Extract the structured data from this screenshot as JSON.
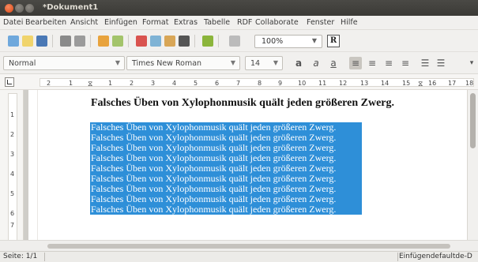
{
  "window": {
    "title": "*Dokument1"
  },
  "menu": [
    "Datei",
    "Bearbeiten",
    "Ansicht",
    "Einfügen",
    "Format",
    "Extras",
    "Tabelle",
    "RDF",
    "Collaborate",
    "Fenster",
    "Hilfe"
  ],
  "toolbar": {
    "zoom": "100%",
    "zoom_icon": "chevron-down-icon",
    "r_button": "R"
  },
  "format": {
    "style": "Normal",
    "font": "Times New Roman",
    "size": "14"
  },
  "ruler": {
    "labels": [
      "2",
      "1",
      "1",
      "2",
      "3",
      "4",
      "5",
      "6",
      "7",
      "8",
      "9",
      "10",
      "11",
      "12",
      "13",
      "14",
      "15",
      "16",
      "17",
      "18"
    ]
  },
  "vruler": {
    "labels": [
      "1",
      "2",
      "3",
      "4",
      "5",
      "6",
      "7"
    ]
  },
  "document": {
    "heading": "Falsches Üben von Xylophonmusik quält jeden größeren Zwerg.",
    "lines": [
      "Falsches Üben von Xylophonmusik quält jeden größeren Zwerg.",
      "Falsches Üben von Xylophonmusik quält jeden größeren Zwerg.",
      "Falsches Üben von Xylophonmusik quält jeden größeren Zwerg.",
      "Falsches Üben von Xylophonmusik quält jeden größeren Zwerg.",
      "Falsches Üben von Xylophonmusik quält jeden größeren Zwerg.",
      "Falsches Üben von Xylophonmusik quält jeden größeren Zwerg.",
      "Falsches Üben von Xylophonmusik quält jeden größeren Zwerg.",
      "Falsches Üben von Xylophonmusik quält jeden größeren Zwerg.",
      "Falsches Üben von Xylophonmusik quält jeden größeren Zwerg."
    ]
  },
  "status": {
    "page": "Seite: 1/1",
    "mode": "Einfügen",
    "lang": "default",
    "locale": "de-D"
  },
  "colors": {
    "selection": "#2e8fd8",
    "titlebar": "#3b3a36",
    "accent": "#dd4814"
  }
}
